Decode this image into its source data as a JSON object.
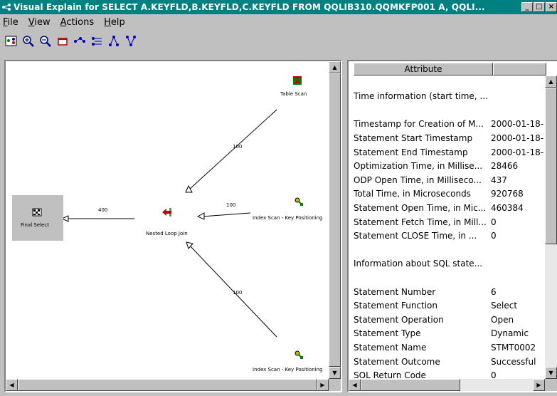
{
  "window": {
    "title": "Visual Explain for SELECT A.KEYFLD,B.KEYFLD,C.KEYFLD   FROM  QQLIB310.QQMKFP001 A,    QQLI...",
    "app_icon": "graph-icon",
    "min_label": "_",
    "max_label": "□",
    "close_label": "×"
  },
  "menu": [
    "File",
    "View",
    "Actions",
    "Help"
  ],
  "toolbar": {
    "items": [
      "graph-overview-icon",
      "zoom-in-icon",
      "zoom-out-icon",
      "window-icon",
      "horizontal-layout-icon",
      "vertical-layout-icon",
      "tree-layout-icon",
      "tree-alt-layout-icon"
    ]
  },
  "graph": {
    "nodes": {
      "table_scan": "Table Scan",
      "index_scan_1": "Index Scan - Key Positioning",
      "index_scan_2": "Index Scan - Key Positioning",
      "nested_loop": "Nested Loop Join",
      "final_select": "Final Select"
    },
    "edges": {
      "final_to_join": "400",
      "join_to_table": "100",
      "join_to_index1": "100",
      "join_to_index2": "100"
    }
  },
  "attributes": {
    "col_attribute": "Attribute",
    "col_value": "",
    "rows": [
      [
        "",
        ""
      ],
      [
        "Time information (start time, ...",
        ""
      ],
      [
        "",
        ""
      ],
      [
        "Timestamp for Creation of M...",
        "2000-01-18-"
      ],
      [
        "Statement Start Timestamp",
        "2000-01-18-"
      ],
      [
        "Statement End Timestamp",
        "2000-01-18-"
      ],
      [
        "Optimization Time, in Millise...",
        "28466"
      ],
      [
        "ODP Open Time, in Milliseco...",
        "437"
      ],
      [
        "Total Time, in Microseconds",
        "920768"
      ],
      [
        "Statement Open Time, in Mic...",
        "460384"
      ],
      [
        "Statement Fetch Time, in Mill...",
        "0"
      ],
      [
        "Statement CLOSE Time, in ...",
        "0"
      ],
      [
        "",
        ""
      ],
      [
        "Information about SQL state...",
        ""
      ],
      [
        "",
        ""
      ],
      [
        "Statement Number",
        "6"
      ],
      [
        "Statement Function",
        "Select"
      ],
      [
        "Statement Operation",
        "Open"
      ],
      [
        "Statement Type",
        "Dynamic"
      ],
      [
        "Statement Name",
        "STMT0002"
      ],
      [
        "Statement Outcome",
        "Successful"
      ],
      [
        "SQL Return Code",
        "0"
      ]
    ]
  }
}
